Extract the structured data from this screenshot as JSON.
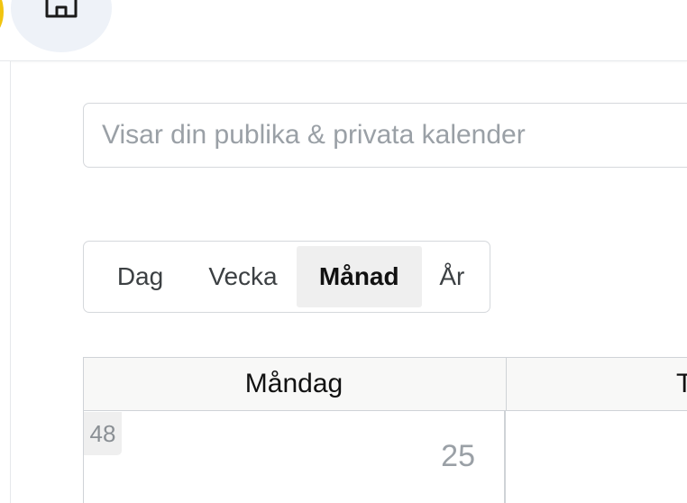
{
  "header": {
    "home_icon": "home-icon"
  },
  "search": {
    "placeholder": "Visar din publika & privata kalender"
  },
  "view_switch": {
    "tabs": [
      {
        "label": "Dag"
      },
      {
        "label": "Vecka"
      },
      {
        "label": "Månad",
        "active": true
      },
      {
        "label": "År"
      }
    ]
  },
  "calendar": {
    "days": [
      "Måndag",
      "T"
    ],
    "rows": [
      {
        "week": "48",
        "day": "25"
      }
    ]
  },
  "colors": {
    "accent_yellow": "#f1c40f",
    "home_bg": "#eef2f8",
    "active_tab_bg": "#efefef"
  }
}
